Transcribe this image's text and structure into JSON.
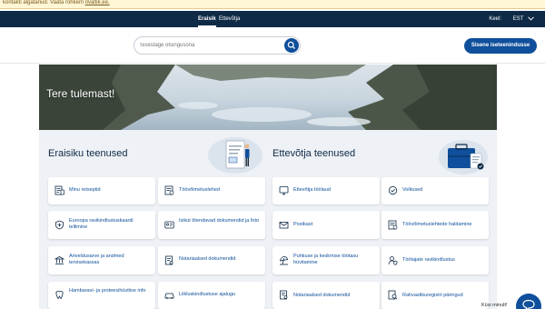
{
  "cookie": {
    "text": "kontakti algatanud. Vaata rohkem ",
    "link": "rivaltik.ee."
  },
  "topnav": {
    "tabs": [
      {
        "label": "Eraisik"
      },
      {
        "label": "Ettevõtja"
      }
    ],
    "language_label": "Keel:",
    "language_value": "EST"
  },
  "search": {
    "placeholder": "Sisestage otsingusõna"
  },
  "login": {
    "label": "Sisene iseteenindusse"
  },
  "hero": {
    "title": "Tere tulemast!"
  },
  "private": {
    "title": "Eraisiku teenused",
    "cards": [
      {
        "label": "Minu retseptid"
      },
      {
        "label": "Töövõimetuslehed"
      },
      {
        "label": "Euroopa ravikindlustuskaardi tellimine"
      },
      {
        "label": "Isikut tõendavad dokumendid ja foto"
      },
      {
        "label": "Ariveldusarve ja andmed tervisekassas"
      },
      {
        "label": "Notariaalsed dokumendid"
      },
      {
        "label": "Hambaravi- ja proteesihüvitise info"
      },
      {
        "label": "Liikluskindlustuse ajalugu"
      }
    ]
  },
  "business": {
    "title": "Ettevõtja teenused",
    "cards": [
      {
        "label": "Ettevõtja töölaud"
      },
      {
        "label": "Volitused"
      },
      {
        "label": "Postkast"
      },
      {
        "label": "Töövõimetuslehtede haldamine"
      },
      {
        "label": "Puhkuse ja keskmise töötasu hüvitamine"
      },
      {
        "label": "Töötajate ravikindlustus"
      },
      {
        "label": "Notariaalsed dokumendid"
      },
      {
        "label": "Rahvastikuregistri päringud"
      }
    ]
  },
  "chat": {
    "label": "Küsi minult!"
  },
  "colors": {
    "primary": "#0f4f9b",
    "dark_nav": "#0e2a47",
    "services_bg": "#eef1f5"
  }
}
